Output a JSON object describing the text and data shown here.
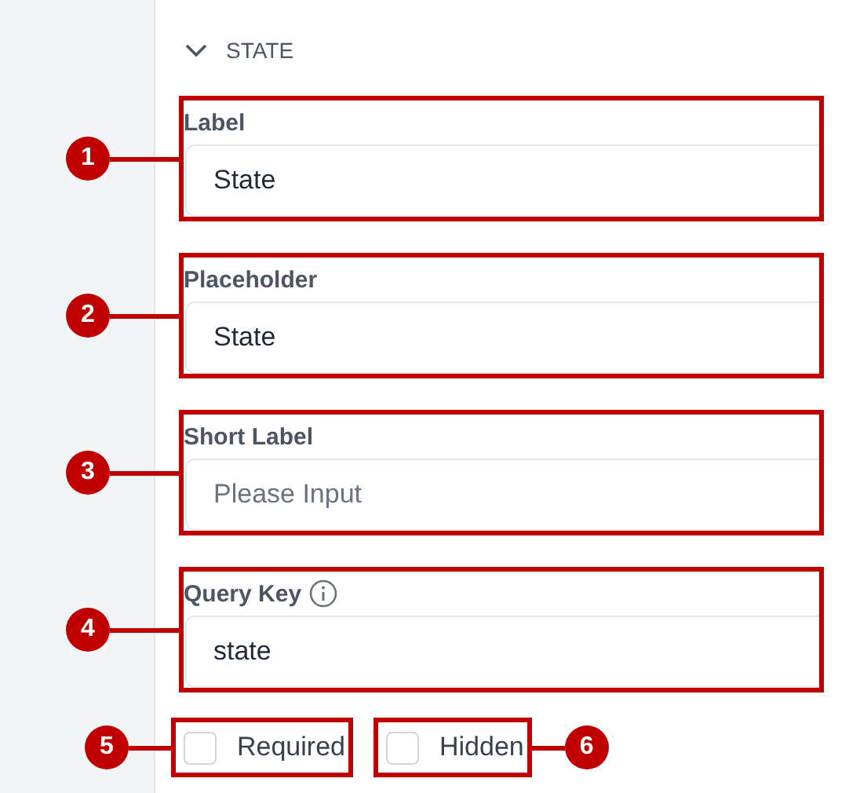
{
  "section": {
    "title": "STATE",
    "expanded": true
  },
  "fields": [
    {
      "label": "Label",
      "value": "State",
      "info": false,
      "callout": "1"
    },
    {
      "label": "Placeholder",
      "value": "State",
      "info": false,
      "callout": "2"
    },
    {
      "label": "Short Label",
      "placeholder": "Please Input",
      "info": false,
      "callout": "3"
    },
    {
      "label": "Query Key",
      "value": "state",
      "info": true,
      "callout": "4"
    }
  ],
  "checkboxes": [
    {
      "label": "Required",
      "checked": false,
      "callout": "5",
      "callout_right": false
    },
    {
      "label": "Hidden",
      "checked": false,
      "callout": "6",
      "callout_right": true
    }
  ]
}
